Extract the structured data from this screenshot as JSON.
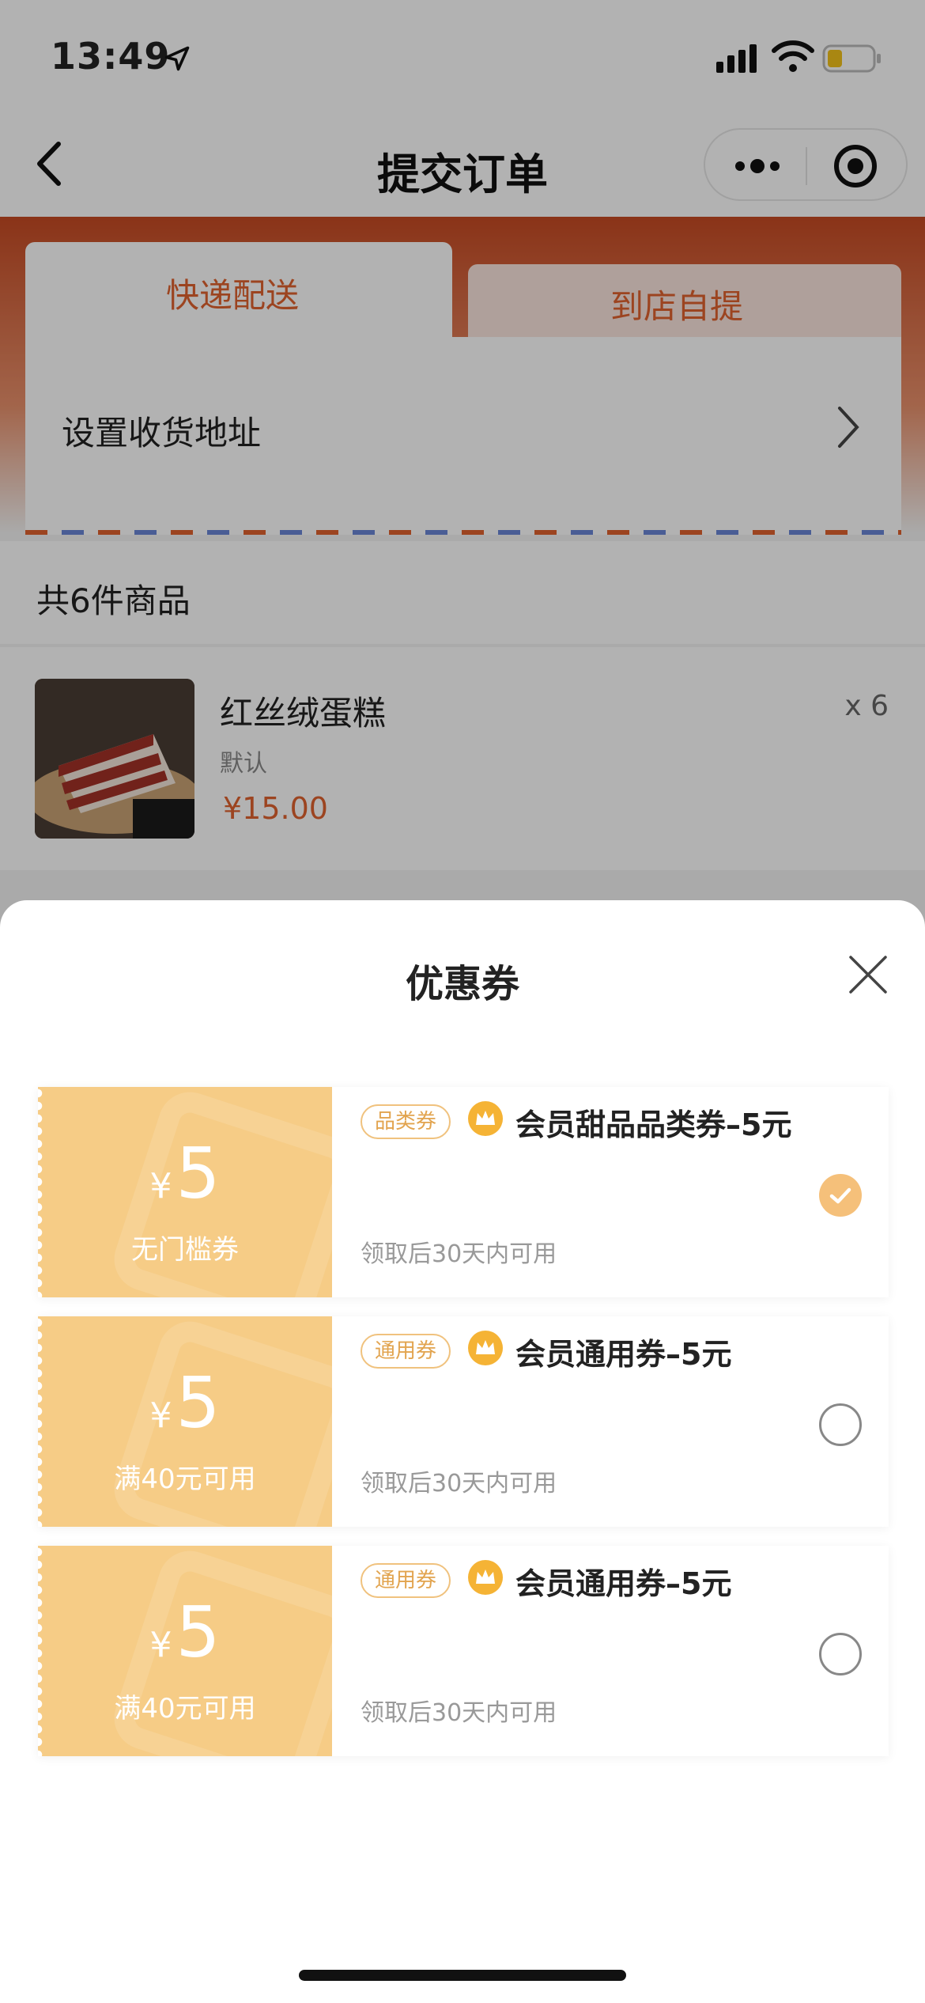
{
  "status_bar": {
    "time": "13:49"
  },
  "nav": {
    "title": "提交订单"
  },
  "delivery_tabs": [
    {
      "label": "快递配送",
      "active": true
    },
    {
      "label": "到店自提",
      "active": false
    }
  ],
  "address": {
    "placeholder_label": "设置收货地址"
  },
  "order": {
    "item_count_label": "共6件商品",
    "items": [
      {
        "name": "红丝绒蛋糕",
        "spec": "默认",
        "price": "¥15.00",
        "quantity": "x 6"
      }
    ]
  },
  "coupon_sheet": {
    "title": "优惠券",
    "coupons": [
      {
        "currency": "¥",
        "amount": "5",
        "condition": "无门槛券",
        "tag": "品类券",
        "title": "会员甜品品类券–5元",
        "validity": "领取后30天内可用",
        "selected": true
      },
      {
        "currency": "¥",
        "amount": "5",
        "condition": "满40元可用",
        "tag": "通用券",
        "title": "会员通用券–5元",
        "validity": "领取后30天内可用",
        "selected": false
      },
      {
        "currency": "¥",
        "amount": "5",
        "condition": "满40元可用",
        "tag": "通用券",
        "title": "会员通用券–5元",
        "validity": "领取后30天内可用",
        "selected": false
      }
    ]
  },
  "colors": {
    "accent": "#e0622e",
    "coupon_gold": "#f6cc86",
    "tag_text": "#e2a44f"
  }
}
